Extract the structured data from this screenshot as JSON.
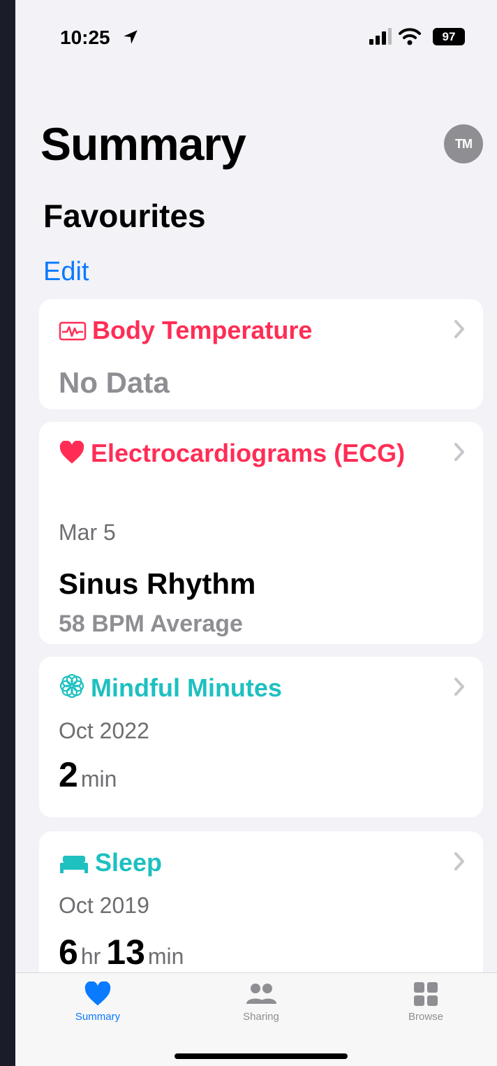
{
  "status_bar": {
    "time": "10:25",
    "battery": "97"
  },
  "header": {
    "title": "Summary",
    "avatar_initials": "TM"
  },
  "favourites": {
    "title": "Favourites",
    "edit_label": "Edit"
  },
  "cards": [
    {
      "title": "Body Temperature",
      "icon": "waveform-icon",
      "color": "#ff2d55",
      "no_data": "No Data"
    },
    {
      "title": "Electrocardiograms (ECG)",
      "icon": "heart-icon",
      "color": "#ff2d55",
      "date": "Mar 5",
      "value": "Sinus Rhythm",
      "sub_value": "58 BPM Average"
    },
    {
      "title": "Mindful Minutes",
      "icon": "mindfulness-icon",
      "color": "#1ec0c0",
      "date": "Oct 2022",
      "value": "2",
      "unit": "min"
    },
    {
      "title": "Sleep",
      "icon": "bed-icon",
      "color": "#1ec0c0",
      "date": "Oct 2019",
      "value_hours": "6",
      "unit_hours": "hr",
      "value_minutes": "13",
      "unit_minutes": "min"
    }
  ],
  "tabs": [
    {
      "label": "Summary",
      "icon": "heart-icon",
      "active": true
    },
    {
      "label": "Sharing",
      "icon": "people-icon",
      "active": false
    },
    {
      "label": "Browse",
      "icon": "grid-icon",
      "active": false
    }
  ],
  "colors": {
    "accent": "#0a7aff",
    "heart_red": "#ff2d55",
    "mint": "#1ec0c0"
  }
}
